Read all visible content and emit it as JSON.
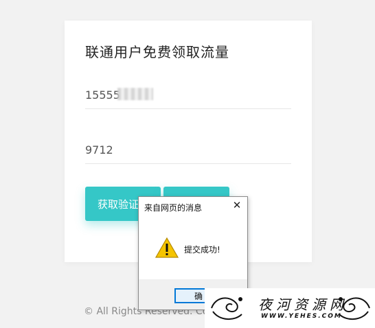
{
  "card": {
    "title": "联通用户免费领取流量",
    "phone_value": "15555",
    "code_value": "9712",
    "get_code_label": "获取验证",
    "submit_label": ""
  },
  "footer": {
    "copyright": "© All Rights Reserved. Colle"
  },
  "dialog": {
    "title": "来自网页的消息",
    "close_glyph": "✕",
    "message": "提交成功!",
    "ok_label": "确"
  },
  "watermark": {
    "text": "夜河资源网",
    "url": "WWW.YEHES.COM"
  },
  "colors": {
    "accent": "#35c7c7",
    "background": "#f2f2f2",
    "warning": "#f5c400"
  }
}
